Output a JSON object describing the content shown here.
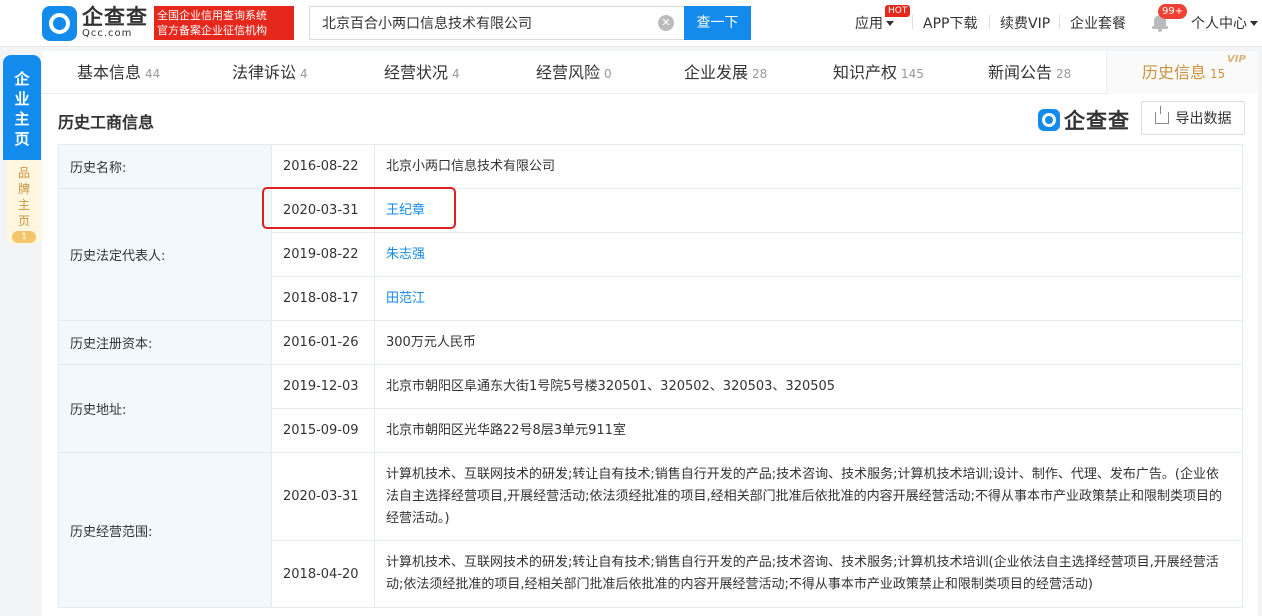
{
  "header": {
    "logo_cn": "企查查",
    "logo_en": "Qcc.com",
    "logo_badge": "全国企业信用查询系统\n官方备案企业征信机构",
    "search_value": "北京百合小两口信息技术有限公司",
    "search_button": "查一下",
    "nav": {
      "app": "应用",
      "app_hot": "HOT",
      "app_download": "APP下载",
      "vip": "续费VIP",
      "enterprise_pkg": "企业套餐",
      "notifications": "99+",
      "personal": "个人中心"
    }
  },
  "side": {
    "main": "企业主页",
    "brand": "品牌主页",
    "brand_count": "1"
  },
  "tabs": [
    {
      "label": "基本信息",
      "count": "44"
    },
    {
      "label": "法律诉讼",
      "count": "4"
    },
    {
      "label": "经营状况",
      "count": "4"
    },
    {
      "label": "经营风险",
      "count": "0"
    },
    {
      "label": "企业发展",
      "count": "28"
    },
    {
      "label": "知识产权",
      "count": "145"
    },
    {
      "label": "新闻公告",
      "count": "28"
    },
    {
      "label": "历史信息",
      "count": "15",
      "active": true,
      "tag": "VIP"
    }
  ],
  "section": {
    "title": "历史工商信息",
    "brand_mark": "企查查",
    "export_label": "导出数据"
  },
  "table": {
    "name_label": "历史名称:",
    "name_rows": [
      {
        "date": "2016-08-22",
        "value": "北京小两口信息技术有限公司"
      }
    ],
    "rep_label": "历史法定代表人:",
    "rep_rows": [
      {
        "date": "2020-03-31",
        "value": "王纪章"
      },
      {
        "date": "2019-08-22",
        "value": "朱志强"
      },
      {
        "date": "2018-08-17",
        "value": "田范江"
      }
    ],
    "capital_label": "历史注册资本:",
    "capital_rows": [
      {
        "date": "2016-01-26",
        "value": "300万元人民币"
      }
    ],
    "address_label": "历史地址:",
    "address_rows": [
      {
        "date": "2019-12-03",
        "value": "北京市朝阳区阜通东大街1号院5号楼320501、320502、320503、320505"
      },
      {
        "date": "2015-09-09",
        "value": "北京市朝阳区光华路22号8层3单元911室"
      }
    ],
    "scope_label": "历史经营范围:",
    "scope_rows": [
      {
        "date": "2020-03-31",
        "value": "计算机技术、互联网技术的研发;转让自有技术;销售自行开发的产品;技术咨询、技术服务;计算机技术培训;设计、制作、代理、发布广告。(企业依法自主选择经营项目,开展经营活动;依法须经批准的项目,经相关部门批准后依批准的内容开展经营活动;不得从事本市产业政策禁止和限制类项目的经营活动。)"
      },
      {
        "date": "2018-04-20",
        "value": "计算机技术、互联网技术的研发;转让自有技术;销售自行开发的产品;技术咨询、技术服务;计算机技术培训(企业依法自主选择经营项目,开展经营活动;依法须经批准的项目,经相关部门批准后依批准的内容开展经营活动;不得从事本市产业政策禁止和限制类项目的经营活动)"
      }
    ]
  },
  "colors": {
    "brand_blue": "#128bed",
    "active_tab_gold": "#c9923e",
    "highlight_red": "#e02020"
  }
}
